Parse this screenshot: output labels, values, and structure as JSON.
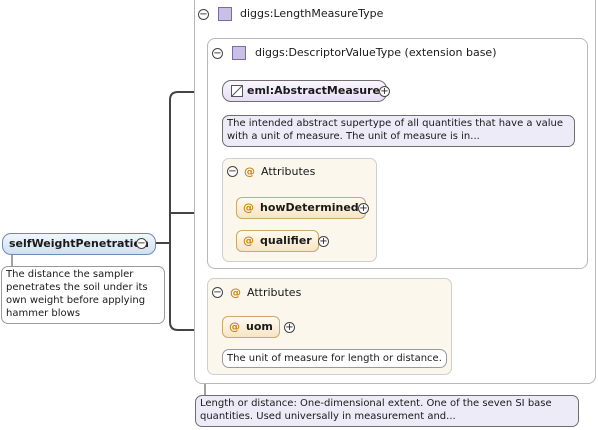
{
  "root": {
    "name": "selfWeightPenetration",
    "doc": "The distance the sampler penetrates the soil under its own weight before applying hammer blows"
  },
  "type_box": {
    "title": "diggs:LengthMeasureType",
    "doc": "Length or distance: One-dimensional extent. One of the seven SI base quantities. Used universally in measurement and..."
  },
  "base_box": {
    "title": "diggs:DescriptorValueType (extension base)"
  },
  "abstract_measure": {
    "name": "eml:AbstractMeasure",
    "doc": "The intended abstract supertype of all quantities that have a value with a unit of measure. The unit of measure is in..."
  },
  "inner_attributes": {
    "title": "Attributes",
    "items": [
      "howDetermined",
      "qualifier"
    ]
  },
  "outer_attributes": {
    "title": "Attributes",
    "uom": "uom",
    "uom_doc": "The unit of measure for length or distance."
  },
  "symbols": {
    "collapse": "−",
    "expand": "+",
    "attr": "@"
  },
  "colors": {
    "attr_at": "#c8831a",
    "complex_type": "#c9bfe7",
    "element_root": "#cfdff1"
  }
}
